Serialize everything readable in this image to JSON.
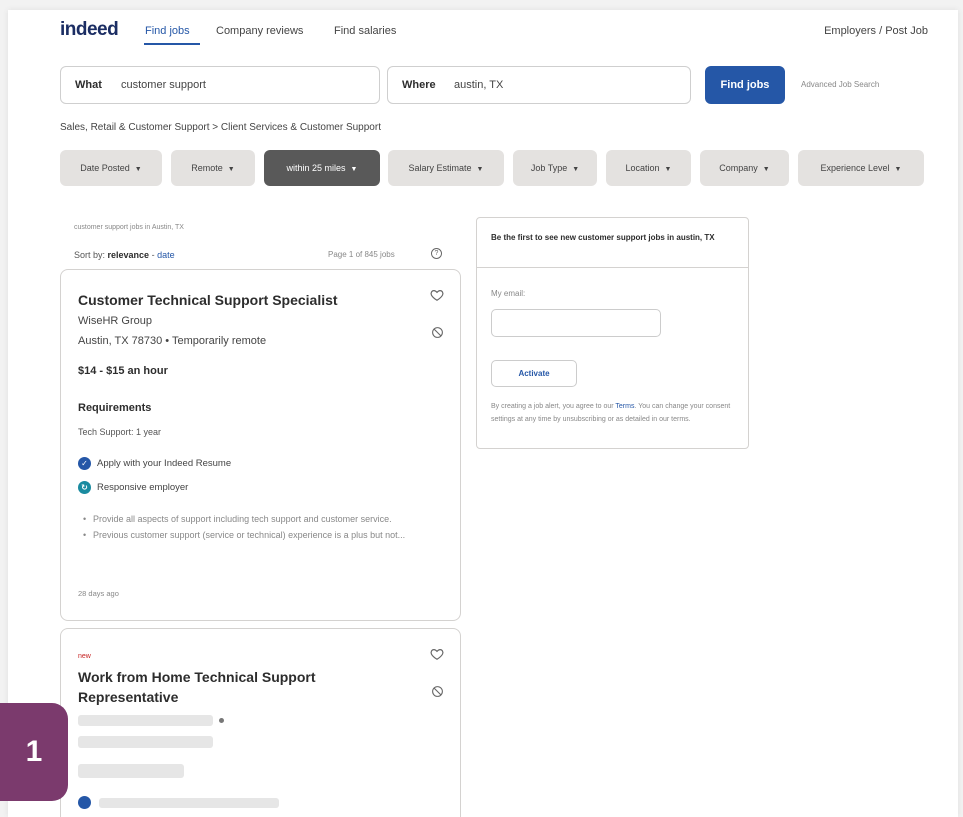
{
  "header": {
    "logo": "indeed",
    "nav": [
      "Find jobs",
      "Company reviews",
      "Find salaries"
    ],
    "employers": "Employers / Post Job"
  },
  "search": {
    "what_label": "What",
    "what_value": "customer support",
    "where_label": "Where",
    "where_value": "austin, TX",
    "find_button": "Find jobs",
    "advanced": "Advanced Job Search"
  },
  "breadcrumb": "Sales, Retail & Customer Support > Client Services & Customer Support",
  "filters": [
    {
      "label": "Date Posted",
      "active": false
    },
    {
      "label": "Remote",
      "active": false
    },
    {
      "label": "within 25 miles",
      "active": true
    },
    {
      "label": "Salary Estimate",
      "active": false
    },
    {
      "label": "Job Type",
      "active": false
    },
    {
      "label": "Location",
      "active": false
    },
    {
      "label": "Company",
      "active": false
    },
    {
      "label": "Experience Level",
      "active": false
    }
  ],
  "results": {
    "small_heading": "customer support jobs in Austin, TX",
    "sort_prefix": "Sort by:",
    "sort_relevance": "relevance",
    "sort_sep": " - ",
    "sort_date": "date",
    "page_info": "Page 1 of 845 jobs"
  },
  "jobs": [
    {
      "title": "Customer Technical Support Specialist",
      "company": "WiseHR Group",
      "location": "Austin, TX 78730 • Temporarily remote",
      "salary": "$14 - $15 an hour",
      "requirements_heading": "Requirements",
      "requirement": "Tech Support: 1 year",
      "badges": [
        {
          "text": "Apply with your Indeed Resume",
          "color": "#2557a7",
          "icon": "check-icon"
        },
        {
          "text": "Responsive employer",
          "color": "#1a8ba0",
          "icon": "responsive-icon"
        }
      ],
      "bullets": [
        "Provide all aspects of support including tech support and customer service.",
        "Previous customer support (service or technical) experience is a plus but not..."
      ],
      "posted": "28 days ago"
    },
    {
      "tag": "new",
      "title": "Work from Home Technical Support Representative"
    }
  ],
  "alert": {
    "heading": "Be the first to see new customer support jobs in austin, TX",
    "email_label": "My email:",
    "activate": "Activate",
    "fine_before": "By creating a job alert, you agree to our ",
    "terms": "Terms",
    "fine_after": ". You can change your consent settings at any time by unsubscribing or as detailed in our terms."
  },
  "step_badge": "1"
}
